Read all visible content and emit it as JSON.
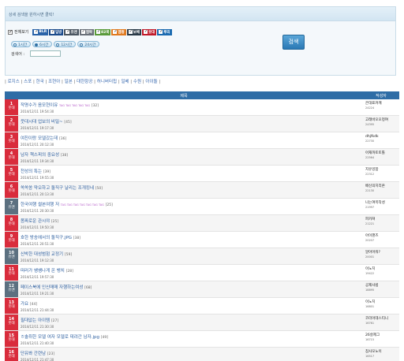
{
  "search": {
    "header_text": "상세 검색을 원하시면 클릭!",
    "select_all_label": "전체보기",
    "filters": [
      {
        "label": "BLR",
        "color": "#2a63a8",
        "checked": true
      },
      {
        "label": "딥방",
        "color": "#1b4b8c",
        "checked": true
      },
      {
        "label": "유엔",
        "color": "#4a5560",
        "checked": true
      },
      {
        "label": "엠팍",
        "color": "#6a7078",
        "checked": true
      },
      {
        "label": "82쿡",
        "color": "#5a9a3a",
        "checked": true
      },
      {
        "label": "엠펑",
        "color": "#e07a20",
        "checked": true
      },
      {
        "label": "보배",
        "color": "#2a3a48",
        "checked": true
      },
      {
        "label": "웃대",
        "color": "#c01a2a",
        "checked": true
      },
      {
        "label": "루리",
        "color": "#1a6ab0",
        "checked": true
      }
    ],
    "time_options": [
      {
        "label": "1시간",
        "selected": false
      },
      {
        "label": "6시간",
        "selected": true
      },
      {
        "label": "12시간",
        "selected": false
      },
      {
        "label": "24시간",
        "selected": false
      }
    ],
    "keyword_label": "검색어 :",
    "keyword_value": "",
    "button_label": "검색"
  },
  "categories": [
    "로지스",
    "스포",
    "한국",
    "조현아",
    "일본",
    "대한항공",
    "허니버터칩",
    "일베",
    "수원",
    "아이돌"
  ],
  "table": {
    "col_title": "제목",
    "col_author": "작성자",
    "rows": [
      {
        "rank": "1",
        "badge": "웃대",
        "type": "humor",
        "title": "작명수가 음모현이유",
        "tags": "TAG TAG TAG TAG TAG",
        "count": "[32]",
        "date": "2014/12/11 19:54:30",
        "author": "은대표커캐",
        "uid": "24224"
      },
      {
        "rank": "2",
        "badge": "웃대",
        "type": "humor",
        "title": "웃대시대 업보의 비밀~",
        "tags": "",
        "count": "[45]",
        "date": "2014/12/11 19:17:30",
        "author": "고래바오오정여",
        "uid": "24395"
      },
      {
        "rank": "3",
        "badge": "웃대",
        "type": "humor",
        "title": "여친이랑 모델갔는데",
        "tags": "",
        "count": "[36]",
        "date": "2014/12/11 20:12:30",
        "author": "dhjfkdk",
        "uid": "22730"
      },
      {
        "rank": "4",
        "badge": "웃대",
        "type": "humor",
        "title": "남자 책스피의 중요성",
        "tags": "",
        "count": "[38]",
        "date": "2014/12/11 19:34:30",
        "author": "아재까토토톨",
        "uid": "22564"
      },
      {
        "rank": "5",
        "badge": "웃대",
        "type": "humor",
        "title": "천성의 특는",
        "tags": "",
        "count": "[39]",
        "date": "2014/12/11 19:55:30",
        "author": "지유잉함",
        "uid": "22312"
      },
      {
        "rank": "6",
        "badge": "웃대",
        "type": "humor",
        "title": "쏙쏙쏭 약오하고 돌직구 날리는 조개킹네",
        "tags": "",
        "count": "[50]",
        "date": "2014/12/11 20:13:30",
        "author": "배신의치리온",
        "uid": "22130"
      },
      {
        "rank": "7",
        "badge": "유엔",
        "type": "issue",
        "title": "한국여행 썰본여행 저",
        "tags": "TAG TAG TAG TAG TAG TAG TAG",
        "count": "[25]",
        "date": "2014/12/11 20:30:30",
        "author": "나는여목작성",
        "uid": "21997"
      },
      {
        "rank": "8",
        "badge": "웃대",
        "type": "humor",
        "title": "몸짜로운 관시야",
        "tags": "",
        "count": "[25]",
        "date": "2014/12/11 19:50:30",
        "author": "피카쳐",
        "uid": "21221"
      },
      {
        "rank": "9",
        "badge": "웃대",
        "type": "humor",
        "title": "호한 방송에서의 돌직구.JPG",
        "tags": "",
        "count": "[38]",
        "date": "2014/12/11 20:51:30",
        "author": "아이핸즈",
        "uid": "20207"
      },
      {
        "rank": "10",
        "badge": "유엔",
        "type": "issue",
        "title": "신박한 대성범험 교정기",
        "tags": "",
        "count": "[59]",
        "date": "2014/12/11 19:12:30",
        "author": "알아어줘?",
        "uid": "20001"
      },
      {
        "rank": "11",
        "badge": "웃대",
        "type": "humor",
        "title": "떠러가 쌩쌩나게 온 뱅치",
        "tags": "",
        "count": "[28]",
        "date": "2014/12/11 19:57:30",
        "author": "이노치",
        "uid": "19422"
      },
      {
        "rank": "12",
        "badge": "유엔",
        "type": "issue",
        "title": "페이스북에 인신매매 자행하는여성",
        "tags": "",
        "count": "[68]",
        "date": "2014/12/11 19:21:30",
        "author": "공제사범",
        "uid": "18895"
      },
      {
        "rank": "13",
        "badge": "웃대",
        "type": "humor",
        "title": "가요",
        "tags": "",
        "count": "[44]",
        "date": "2014/12/11 21:44:30",
        "author": "이노치",
        "uid": "16801"
      },
      {
        "rank": "14",
        "badge": "웃대",
        "type": "humor",
        "title": "필대없는 아이템",
        "tags": "",
        "count": "[27]",
        "date": "2014/12/11 21:30:30",
        "author": "코리아데스티니",
        "uid": "16761"
      },
      {
        "rank": "15",
        "badge": "웃대",
        "type": "humor",
        "title": "ㅎ솔취한 모델 여자 모델로 데려간 남자.jpg",
        "tags": "",
        "count": "[49]",
        "date": "2014/12/11 21:40:30",
        "author": "26살제그",
        "uid": "16715"
      },
      {
        "rank": "16",
        "badge": "웃대",
        "type": "humor",
        "title": "단유봐 간련남",
        "tags": "",
        "count": "[23]",
        "date": "2014/12/11 21:47:30",
        "author": "참사모노이",
        "uid": "16517"
      }
    ]
  }
}
